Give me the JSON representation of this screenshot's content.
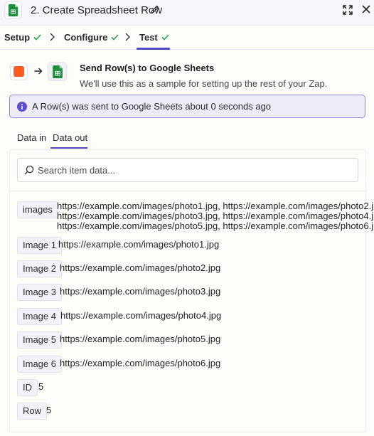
{
  "header": {
    "title": "2. Create Spreadsheet Row",
    "app_icon": "google-sheets-icon",
    "edit_icon": "pencil-icon",
    "expand_icon": "expand-icon",
    "close_icon": "close-icon"
  },
  "steps": [
    {
      "label": "Setup",
      "status": "complete"
    },
    {
      "label": "Configure",
      "status": "complete"
    },
    {
      "label": "Test",
      "status": "complete",
      "active": true
    }
  ],
  "action": {
    "title": "Send Row(s) to Google Sheets",
    "description": "We'll use this as a sample for setting up the rest of your Zap.",
    "trigger_color": "#ff5a1f"
  },
  "info_banner": {
    "text": "A Row(s) was sent to Google Sheets about 0 seconds ago"
  },
  "data_tabs": [
    {
      "label": "Data in",
      "active": false
    },
    {
      "label": "Data out",
      "active": true
    }
  ],
  "search": {
    "placeholder": "Search item data..."
  },
  "fields": [
    {
      "key": "images",
      "value_lines": [
        "https://example.com/images/photo1.jpg, https://example.com/images/photo2.jpg,",
        "https://example.com/images/photo3.jpg, https://example.com/images/photo4.jpg,",
        "https://example.com/images/photo5.jpg, https://example.com/images/photo6.jpg"
      ]
    },
    {
      "key": "Image 1",
      "value": "https://example.com/images/photo1.jpg"
    },
    {
      "key": "Image 2",
      "value": "https://example.com/images/photo2.jpg"
    },
    {
      "key": "Image 3",
      "value": "https://example.com/images/photo3.jpg"
    },
    {
      "key": "Image 4",
      "value": "https://example.com/images/photo4.jpg"
    },
    {
      "key": "Image 5",
      "value": "https://example.com/images/photo5.jpg"
    },
    {
      "key": "Image 6",
      "value": "https://example.com/images/photo6.jpg"
    },
    {
      "key": "ID",
      "value": "5"
    },
    {
      "key": "Row",
      "value": "5"
    }
  ],
  "colors": {
    "accent": "#4f46c8",
    "success": "#2e9e4f",
    "sheets_green": "#1e8e3e"
  }
}
